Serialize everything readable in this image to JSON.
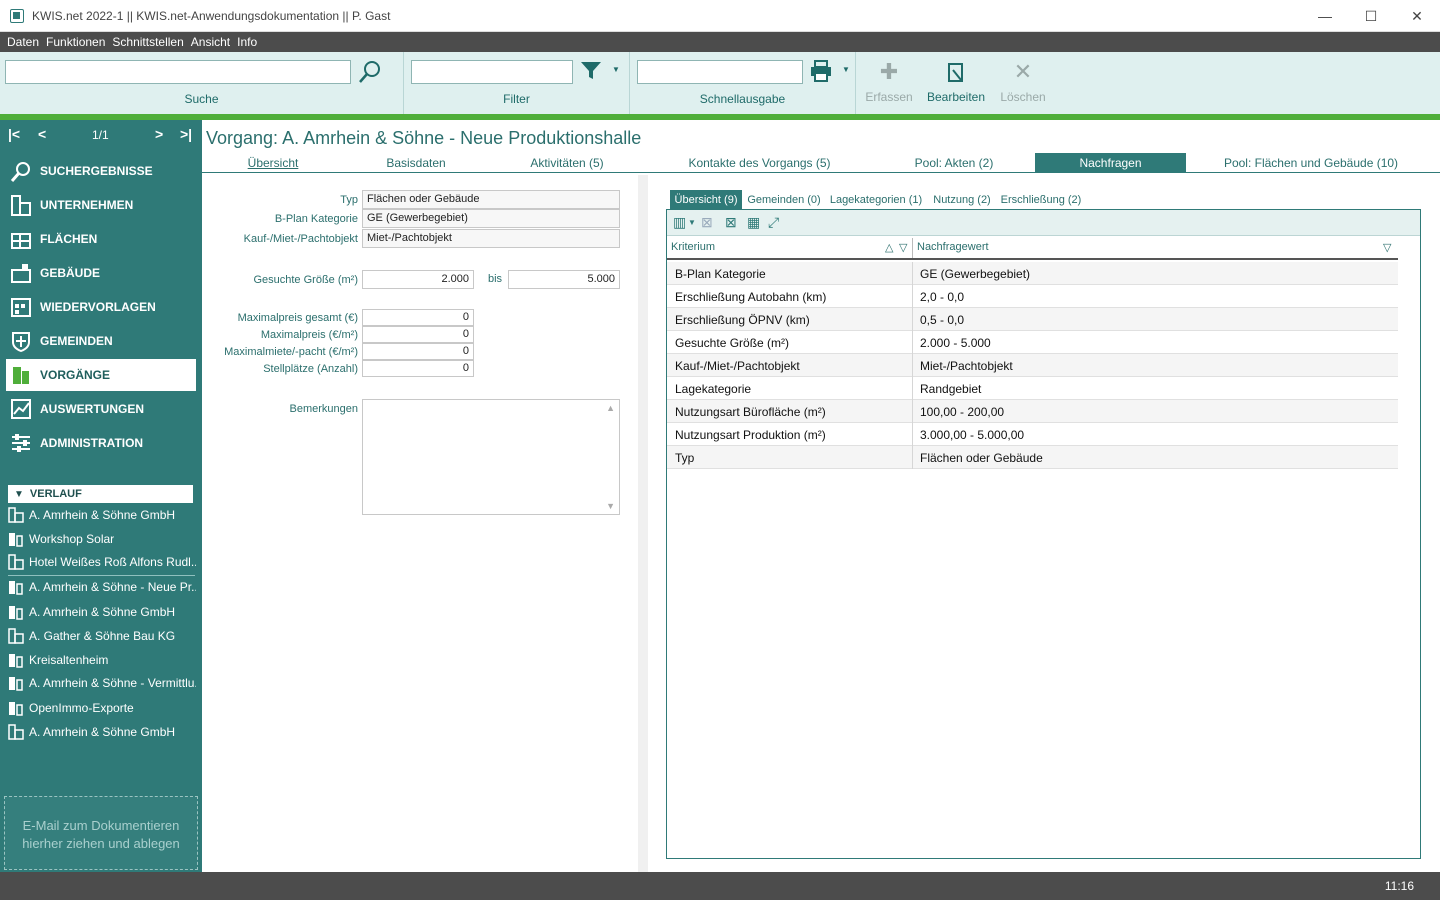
{
  "window": {
    "title": "KWIS.net 2022-1 || KWIS.net-Anwendungsdokumentation || P. Gast",
    "controls": [
      "—",
      "☐",
      "✕"
    ]
  },
  "menu": [
    "Daten",
    "Funktionen",
    "Schnittstellen",
    "Ansicht",
    "Info"
  ],
  "toolbar": {
    "search_label": "Suche",
    "filter_label": "Filter",
    "quick_label": "Schnellausgabe",
    "create_label": "Erfassen",
    "edit_label": "Bearbeiten",
    "delete_label": "Löschen"
  },
  "pager": {
    "text": "1/1"
  },
  "nav": [
    {
      "label": "SUCHERGEBNISSE",
      "icon": "magnifier-icon"
    },
    {
      "label": "UNTERNEHMEN",
      "icon": "company-icon"
    },
    {
      "label": "FLÄCHEN",
      "icon": "area-icon"
    },
    {
      "label": "GEBÄUDE",
      "icon": "building-icon"
    },
    {
      "label": "WIEDERVORLAGEN",
      "icon": "calendar-icon"
    },
    {
      "label": "GEMEINDEN",
      "icon": "shield-icon"
    },
    {
      "label": "VORGÄNGE",
      "icon": "folder-icon"
    },
    {
      "label": "AUSWERTUNGEN",
      "icon": "chart-icon"
    },
    {
      "label": "ADMINISTRATION",
      "icon": "sliders-icon"
    }
  ],
  "verlauf": {
    "header": "VERLAUF",
    "items": [
      "A. Amrhein & Söhne GmbH",
      "Workshop Solar",
      "Hotel Weißes Roß Alfons Rudl...",
      "A. Amrhein & Söhne - Neue Pr...",
      "A. Amrhein & Söhne GmbH",
      "A. Gather & Söhne Bau KG",
      "Kreisaltenheim",
      "A. Amrhein & Söhne - Vermittlu...",
      "OpenImmo-Exporte",
      "A. Amrhein & Söhne GmbH"
    ]
  },
  "mail_drop": "E-Mail  zum Dokumentieren hierher ziehen und ablegen",
  "vorgang_title": "Vorgang: A. Amrhein & Söhne - Neue Produktionshalle",
  "tabs": [
    "Übersicht",
    "Basisdaten",
    "Aktivitäten (5)",
    "Kontakte des Vorgangs (5)",
    "Pool: Akten (2)",
    "Nachfragen",
    "Pool: Flächen und Gebäude (10)"
  ],
  "form": {
    "typ_label": "Typ",
    "typ_value": "Flächen oder Gebäude",
    "bplan_label": "B-Plan Kategorie",
    "bplan_value": "GE (Gewerbegebiet)",
    "kauf_label": "Kauf-/Miet-/Pachtobjekt",
    "kauf_value": "Miet-/Pachtobjekt",
    "groesse_label": "Gesuchte Größe (m²)",
    "groesse_from": "2.000",
    "bis_label": "bis",
    "groesse_to": "5.000",
    "maxgesamt_label": "Maximalpreis gesamt (€)",
    "maxgesamt_value": "0",
    "maxpreis_label": "Maximalpreis (€/m²)",
    "maxpreis_value": "0",
    "maxmiete_label": "Maximalmiete/-pacht (€/m²)",
    "maxmiete_value": "0",
    "stellplaetze_label": "Stellplätze (Anzahl)",
    "stellplaetze_value": "0",
    "bemerkungen_label": "Bemerkungen"
  },
  "subtabs": [
    "Übersicht (9)",
    "Gemeinden (0)",
    "Lagekategorien (1)",
    "Nutzung (2)",
    "Erschließung (2)"
  ],
  "grid": {
    "col1": "Kriterium",
    "col2": "Nachfragewert",
    "rows": [
      [
        "B-Plan Kategorie",
        "GE (Gewerbegebiet)"
      ],
      [
        "Erschließung Autobahn (km)",
        "2,0 - 0,0"
      ],
      [
        "Erschließung ÖPNV (km)",
        "0,5 - 0,0"
      ],
      [
        "Gesuchte Größe (m²)",
        "2.000 - 5.000"
      ],
      [
        "Kauf-/Miet-/Pachtobjekt",
        "Miet-/Pachtobjekt"
      ],
      [
        "Lagekategorie",
        "Randgebiet"
      ],
      [
        "Nutzungsart Bürofläche (m²)",
        "100,00 - 200,00"
      ],
      [
        "Nutzungsart Produktion (m²)",
        "3.000,00 - 5.000,00"
      ],
      [
        "Typ",
        "Flächen oder Gebäude"
      ]
    ]
  },
  "status": {
    "clock": "11:16"
  },
  "colors": {
    "teal": "#2f7a78",
    "green": "#4fae3a",
    "menubar": "#4c4c4c"
  }
}
